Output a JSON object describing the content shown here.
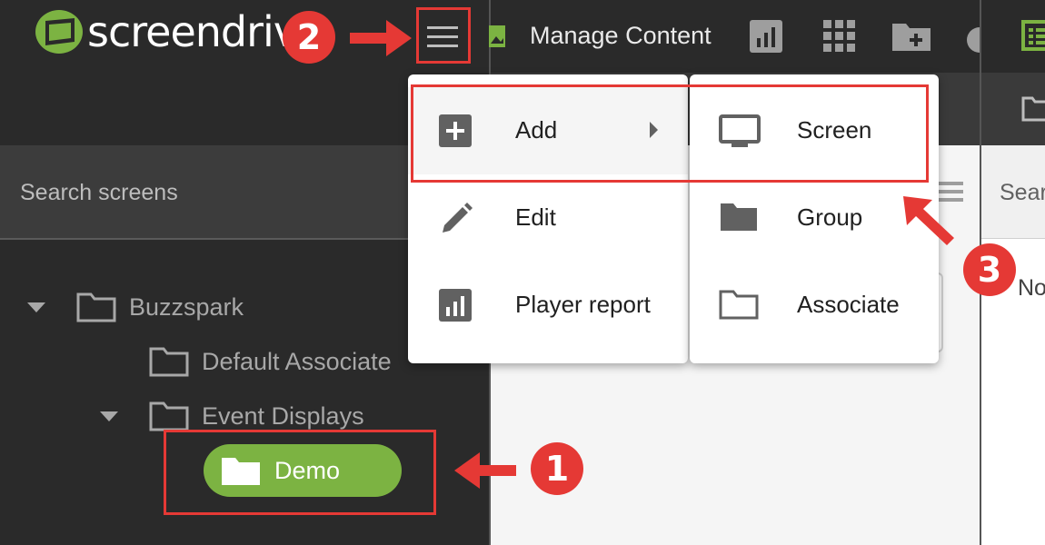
{
  "app": {
    "logo_text_a": "screen",
    "logo_text_b": "driv",
    "brand_color": "#7cb342"
  },
  "topbar": {
    "title": "Manage Content",
    "icons": [
      "image-icon",
      "bar-chart-icon",
      "grid-icon",
      "folder-add-icon",
      "cloud-icon",
      "table-icon"
    ]
  },
  "sidebar": {
    "search_placeholder": "Search screens",
    "tree": [
      {
        "label": "Buzzspark",
        "expanded": true
      },
      {
        "label": "Default Associate",
        "expanded": false
      },
      {
        "label": "Event Displays",
        "expanded": true
      },
      {
        "label": "Demo",
        "selected": true
      }
    ]
  },
  "menu_primary": {
    "items": [
      {
        "label": "Add",
        "icon": "plus-square-icon",
        "has_submenu": true
      },
      {
        "label": "Edit",
        "icon": "pencil-icon"
      },
      {
        "label": "Player report",
        "icon": "report-icon"
      }
    ]
  },
  "menu_add": {
    "items": [
      {
        "label": "Screen",
        "icon": "monitor-icon"
      },
      {
        "label": "Group",
        "icon": "folder-filled-icon"
      },
      {
        "label": "Associate",
        "icon": "folder-outline-icon"
      }
    ]
  },
  "right_panel": {
    "search_placeholder": "Sear",
    "content_text": "No"
  },
  "annotations": {
    "badge_1": "1",
    "badge_2": "2",
    "badge_3": "3",
    "color": "#e53935"
  }
}
